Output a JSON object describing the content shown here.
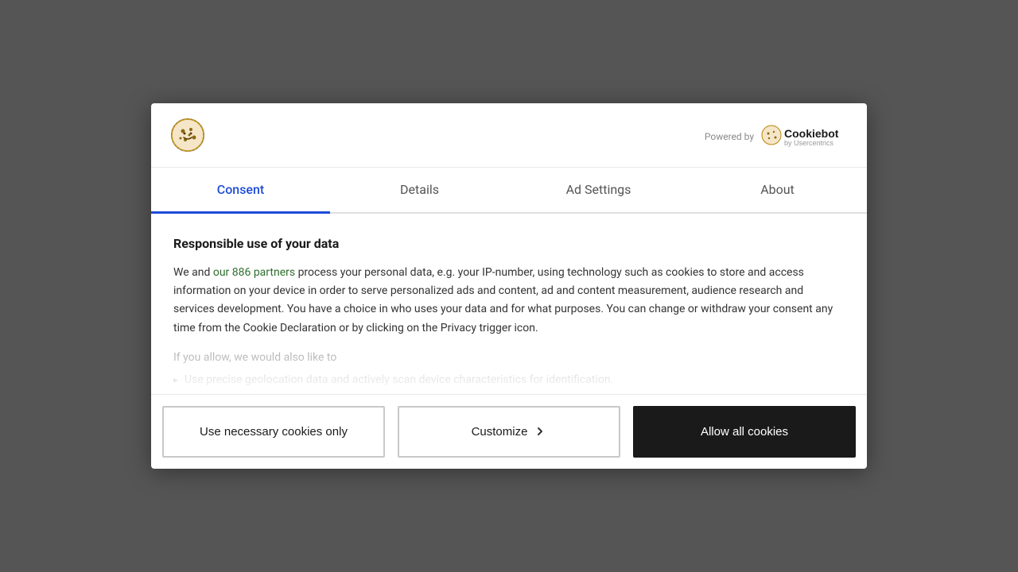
{
  "modal": {
    "header": {
      "powered_by_label": "Powered by",
      "cookiebot_name": "Cookiebot",
      "cookiebot_sub": "by Usercentrics"
    },
    "tabs": [
      {
        "id": "consent",
        "label": "Consent",
        "active": true
      },
      {
        "id": "details",
        "label": "Details",
        "active": false
      },
      {
        "id": "ad-settings",
        "label": "Ad Settings",
        "active": false
      },
      {
        "id": "about",
        "label": "About",
        "active": false
      }
    ],
    "content": {
      "title": "Responsible use of your data",
      "body": "We and our 886 partners process your personal data, e.g. your IP-number, using technology such as cookies to store and access information on your device in order to serve personalized ads and content, ad and content measurement, audience research and services development. You have a choice in who uses your data and for what purposes. You can change or withdraw your consent any time from the Cookie Declaration or by clicking on the Privacy trigger icon.",
      "partners_link_text": "our 886 partners",
      "secondary_text": "If you allow, we would also like to",
      "fade_item_text": "Use precise geolocation data and actively scan device characteristics for identification."
    },
    "buttons": {
      "necessary_only": "Use necessary cookies only",
      "customize": "Customize",
      "allow_all": "Allow all cookies"
    }
  }
}
